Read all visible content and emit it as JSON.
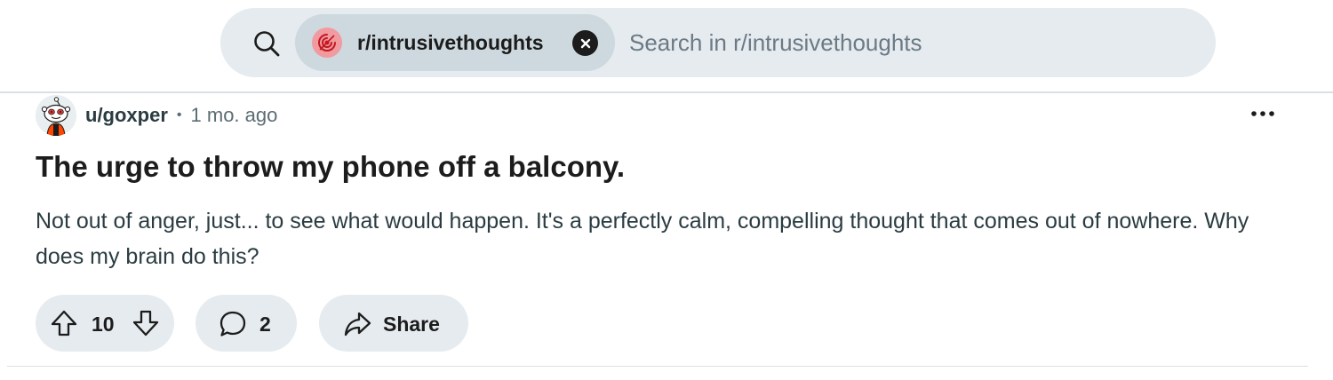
{
  "search": {
    "community": "r/intrusivethoughts",
    "placeholder": "Search in r/intrusivethoughts"
  },
  "post": {
    "author": "u/goxper",
    "separator": "•",
    "time": "1 mo. ago",
    "title": "The urge to throw my phone off a balcony.",
    "body": "Not out of anger, just... to see what would happen. It's a perfectly calm, compelling thought that comes out of nowhere. Why does my brain do this?",
    "votes": "10",
    "comments": "2",
    "share_label": "Share"
  },
  "icons": {
    "search": "search-icon",
    "community": "community-icon",
    "clear": "close-icon",
    "overflow": "more-icon",
    "upvote": "upvote-arrow-icon",
    "downvote": "downvote-arrow-icon",
    "comment": "comment-bubble-icon",
    "share": "share-arrow-icon"
  },
  "colors": {
    "pill_bg": "#e5ebee",
    "chip_bg": "#cdd9df",
    "community_avatar": "#f19aa0",
    "text_primary": "#1c1c1c",
    "text_secondary": "#2a3c42",
    "text_muted": "#5c6c74"
  }
}
